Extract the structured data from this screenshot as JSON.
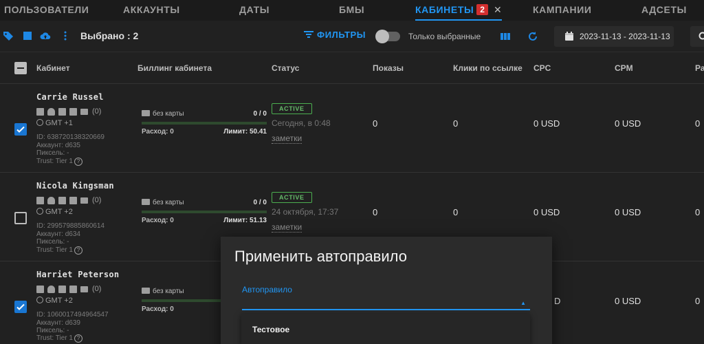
{
  "tabs": [
    {
      "label": "ПОЛЬЗОВАТЕЛИ"
    },
    {
      "label": "АККАУНТЫ"
    },
    {
      "label": "ДАТЫ"
    },
    {
      "label": "БМЫ"
    },
    {
      "label": "КАБИНЕТЫ",
      "badge": "2",
      "active": true
    },
    {
      "label": "КАМПАНИИ"
    },
    {
      "label": "АДСЕТЫ"
    }
  ],
  "toolbar": {
    "selected": "Выбрано : 2",
    "filters": "ФИЛЬТРЫ",
    "only_selected": "Только выбранные",
    "date_range": "2023-11-13 - 2023-11-13"
  },
  "columns": [
    "Кабинет",
    "Биллинг кабинета",
    "Статус",
    "Показы",
    "Клики по ссылке",
    "CPC",
    "CPM",
    "Ра"
  ],
  "rows": [
    {
      "checked": true,
      "name": "Carrie Russel",
      "icons_count": "(0)",
      "gmt": "GMT +1",
      "id": "ID: 638720138320669",
      "account": "Аккаунт: d635",
      "pixels": "Пиксель: -",
      "trust": "Trust: Tier 1",
      "billing_card": "без карты",
      "billing_ratio": "0 / 0",
      "spend": "Расход: 0",
      "limit": "Лимит: 50.41",
      "status": "ACTIVE",
      "status_date": "Сегодня, в 0:48",
      "notes": "заметки",
      "impressions": "0",
      "clicks": "0",
      "cpc": "0 USD",
      "cpm": "0 USD",
      "extra": "0"
    },
    {
      "checked": false,
      "name": "Nicola Kingsman",
      "icons_count": "(0)",
      "gmt": "GMT +2",
      "id": "ID: 299579885860614",
      "account": "Аккаунт: d634",
      "pixels": "Пиксель: -",
      "trust": "Trust: Tier 1",
      "billing_card": "без карты",
      "billing_ratio": "0 / 0",
      "spend": "Расход: 0",
      "limit": "Лимит: 51.13",
      "status": "ACTIVE",
      "status_date": "24 октября, 17:37",
      "notes": "заметки",
      "impressions": "0",
      "clicks": "0",
      "cpc": "0 USD",
      "cpm": "0 USD",
      "extra": "0"
    },
    {
      "checked": true,
      "name": "Harriet Peterson",
      "icons_count": "(0)",
      "gmt": "GMT +2",
      "id": "ID: 1060017494964547",
      "account": "Аккаунт: d639",
      "pixels": "Пиксель: -",
      "trust": "Trust: Tier 1",
      "billing_card": "без карты",
      "spend": "Расход: 0",
      "cpc": "D",
      "cpm": "0 USD",
      "extra": "0"
    }
  ],
  "modal": {
    "title": "Применить автоправило",
    "field_label": "Автоправило",
    "options": [
      "Тестовое"
    ]
  },
  "colors": {
    "accent": "#2196f3",
    "active_status": "#4caf50",
    "checkbox": "#1976d2",
    "badge": "#d32f2f"
  }
}
